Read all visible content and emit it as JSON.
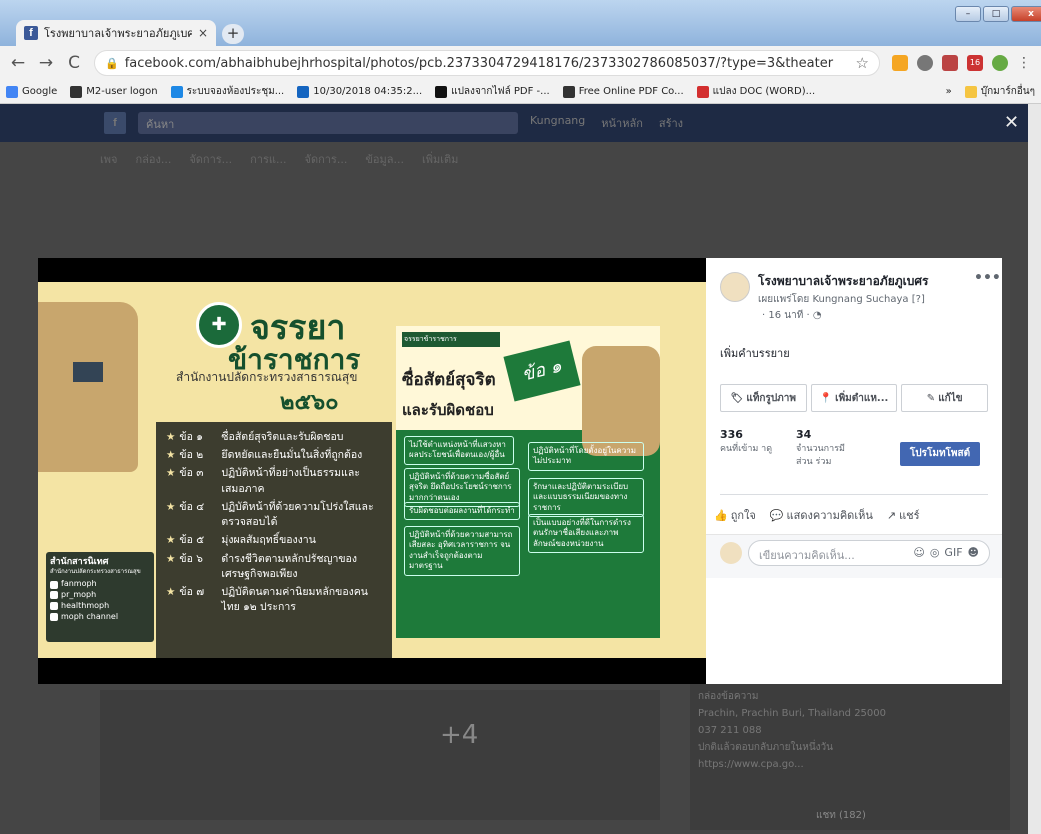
{
  "browser": {
    "tab_title": "โรงพยาบาลเจ้าพระยาอภัยภูเบศร -",
    "tab_close": "×",
    "new_tab": "+",
    "url": "facebook.com/abhaibhubejhrhospital/photos/pcb.2373304729418176/2373302786085037/?type=3&theater",
    "nav": {
      "back": "←",
      "forward": "→",
      "reload": "C"
    },
    "star": "☆",
    "menu": "⋮",
    "badge_count": "16",
    "window": {
      "min": "–",
      "max": "□",
      "close": "x"
    },
    "bookmarks": [
      {
        "label": "Google",
        "color": "#4285f4"
      },
      {
        "label": "M2-user logon",
        "color": "#333333"
      },
      {
        "label": "ระบบจองห้องประชุม...",
        "color": "#1e88e5"
      },
      {
        "label": "10/30/2018 04:35:2...",
        "color": "#1565c0"
      },
      {
        "label": "แปลงจากไฟล์ PDF -...",
        "color": "#111111"
      },
      {
        "label": "Free Online PDF Co...",
        "color": "#333333"
      },
      {
        "label": "แปลง DOC (WORD)...",
        "color": "#d32f2f"
      }
    ],
    "bookmarks_more": "»",
    "bookmarks_folder": "บุ๊กมาร์กอื่นๆ"
  },
  "fb_bg": {
    "search": "ค้นหา",
    "nav": [
      "Kungnang",
      "หน้าหลัก",
      "สร้าง"
    ],
    "tabs": [
      "เพจ",
      "กล่อง...",
      "จัดการ...",
      "การแ...",
      "จัดการ...",
      "ข้อมูล...",
      "เพิ่มเติม"
    ],
    "close": "✕",
    "right_info": [
      "กล่องข้อความ",
      "Prachin, Prachin Buri, Thailand 25000",
      "037 211 088",
      "ปกติแล้วตอบกลับภายในหนึ่งวัน",
      "https://www.cpa.go..."
    ],
    "plus": "+4",
    "chat": "แชท (182)"
  },
  "poster": {
    "title1": "จรรยา",
    "title2": "ข้าราชการ",
    "org": "สำนักงานปลัดกระทรวงสาธารณสุข",
    "year": "๒๕๖๐",
    "seal": "✚",
    "codes": [
      {
        "num": "ข้อ ๑",
        "text": "ซื่อสัตย์สุจริตและรับผิดชอบ"
      },
      {
        "num": "ข้อ ๒",
        "text": "ยึดหยัดและยืนมั่นในสิ่งที่ถูกต้อง"
      },
      {
        "num": "ข้อ ๓",
        "text": "ปฏิบัติหน้าที่อย่างเป็นธรรมและเสมอภาค"
      },
      {
        "num": "ข้อ ๔",
        "text": "ปฏิบัติหน้าที่ด้วยความโปร่งใสและตรวจสอบได้"
      },
      {
        "num": "ข้อ ๕",
        "text": "มุ่งผลสัมฤทธิ์ของงาน"
      },
      {
        "num": "ข้อ ๖",
        "text": "ดำรงชีวิตตามหลักปรัชญาของเศรษฐกิจพอเพียง"
      },
      {
        "num": "ข้อ ๗",
        "text": "ปฏิบัติตนตามค่านิยมหลักของคนไทย ๑๒ ประการ"
      }
    ],
    "credits": {
      "org": "สำนักสารนิเทศ",
      "sub": "สำนักงานปลัดกระทรวงสาธารณสุข",
      "items": [
        "fanmoph",
        "pr_moph",
        "healthmoph",
        "moph channel"
      ]
    },
    "right_head": "จรรยาข้าราชการ",
    "right_badge": "ข้อ ๑",
    "right_title1": "ซื่อสัตย์สุจริต",
    "right_title2": "และรับผิดชอบ",
    "right_boxes": [
      "ไม่ใช้ตำแหน่งหน้าที่แสวงหาผลประโยชน์เพื่อตนเอง/ผู้อื่น",
      "ปฏิบัติหน้าที่ด้วยความซื่อสัตย์สุจริต ยึดถือประโยชน์ราชการมากกว่าตนเอง",
      "รับผิดชอบต่อผลงานที่ได้กระทำ",
      "ปฏิบัติหน้าที่ด้วยความสามารถ เสียสละ อุทิศเวลาราชการ จนงานสำเร็จถูกต้องตามมาตรฐาน",
      "ปฏิบัติหน้าที่โดยตั้งอยู่ในความไม่ประมาท",
      "รักษาและปฏิบัติตามระเบียบและแบบธรรมเนียมของทางราชการ",
      "เป็นแบบอย่างที่ดีในการดำรงตนรักษาชื่อเสียงและภาพลักษณ์ของหน่วยงาน"
    ]
  },
  "side": {
    "page_name": "โรงพยาบาลเจ้าพระยาอภัยภูเบศร",
    "more": "•••",
    "published_by": "เผยแพร่โดย Kungnang Suchaya [?]",
    "time": "· 16 นาที · ◔",
    "add_caption": "เพิ่มคำบรรยาย",
    "actions": [
      {
        "icon": "🏷",
        "label": "แท็กรูปภาพ"
      },
      {
        "icon": "📍",
        "label": "เพิ่มตำแห..."
      },
      {
        "icon": "✎",
        "label": "แก้ไข"
      }
    ],
    "stats": [
      {
        "num": "336",
        "label": "คนที่เข้าม าดู"
      },
      {
        "num": "34",
        "label": "จำนวนการมีส่วน ร่วม"
      }
    ],
    "boost": "โปรโมทโพสต์",
    "reactions": [
      {
        "icon": "👍",
        "label": "ถูกใจ"
      },
      {
        "icon": "💬",
        "label": "แสดงความคิดเห็น"
      },
      {
        "icon": "↗",
        "label": "แชร์"
      }
    ],
    "comment_placeholder": "เขียนความคิดเห็น...",
    "comment_icons": [
      "☺",
      "◎",
      "GIF",
      "☻"
    ]
  }
}
